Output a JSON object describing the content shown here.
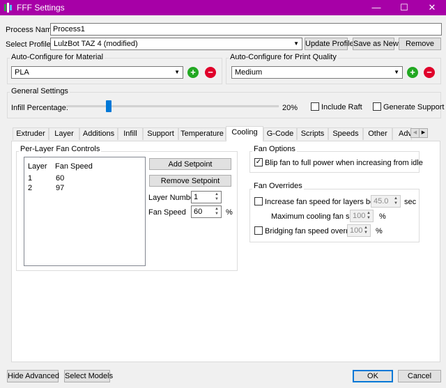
{
  "window": {
    "title": "FFF Settings",
    "minimize": "—",
    "maximize": "☐",
    "close": "✕"
  },
  "process": {
    "label": "Process Name:",
    "value": "Process1"
  },
  "profile": {
    "label": "Select Profile:",
    "value": "LulzBot TAZ 4 (modified)",
    "update": "Update Profile",
    "save_as_new": "Save as New",
    "remove": "Remove"
  },
  "material": {
    "group": "Auto-Configure for Material",
    "value": "PLA"
  },
  "quality": {
    "group": "Auto-Configure for Print Quality",
    "value": "Medium"
  },
  "general": {
    "group": "General Settings",
    "infill_label": "Infill Percentage:",
    "infill_value": "20%",
    "infill_fraction": 0.2,
    "include_raft": "Include Raft",
    "generate_support": "Generate Support"
  },
  "tabs": [
    "Extruder",
    "Layer",
    "Additions",
    "Infill",
    "Support",
    "Temperature",
    "Cooling",
    "G-Code",
    "Scripts",
    "Speeds",
    "Other",
    "Adv"
  ],
  "active_tab": "Cooling",
  "fan_controls": {
    "group": "Per-Layer Fan Controls",
    "headers": [
      "Layer",
      "Fan Speed"
    ],
    "rows": [
      [
        "1",
        "60"
      ],
      [
        "2",
        "97"
      ]
    ],
    "add": "Add Setpoint",
    "remove": "Remove Setpoint",
    "layer_label": "Layer Number",
    "layer_value": "1",
    "speed_label": "Fan Speed",
    "speed_value": "60",
    "unit": "%"
  },
  "fan_options": {
    "group": "Fan Options",
    "blip": "Blip fan to full power when increasing from idle",
    "blip_checked": true
  },
  "fan_overrides": {
    "group": "Fan Overrides",
    "increase_label": "Increase fan speed for layers below",
    "increase_value": "45.0",
    "increase_unit": "sec",
    "max_label": "Maximum cooling fan speed",
    "max_value": "100",
    "max_unit": "%",
    "bridging_label": "Bridging fan speed override",
    "bridging_value": "100",
    "bridging_unit": "%"
  },
  "footer": {
    "hide_advanced": "Hide Advanced",
    "select_models": "Select Models",
    "ok": "OK",
    "cancel": "Cancel"
  },
  "colors": {
    "titlebar": "#a700a7",
    "accent": "#0078d7",
    "add": "#22a822",
    "remove": "#e0002a"
  }
}
